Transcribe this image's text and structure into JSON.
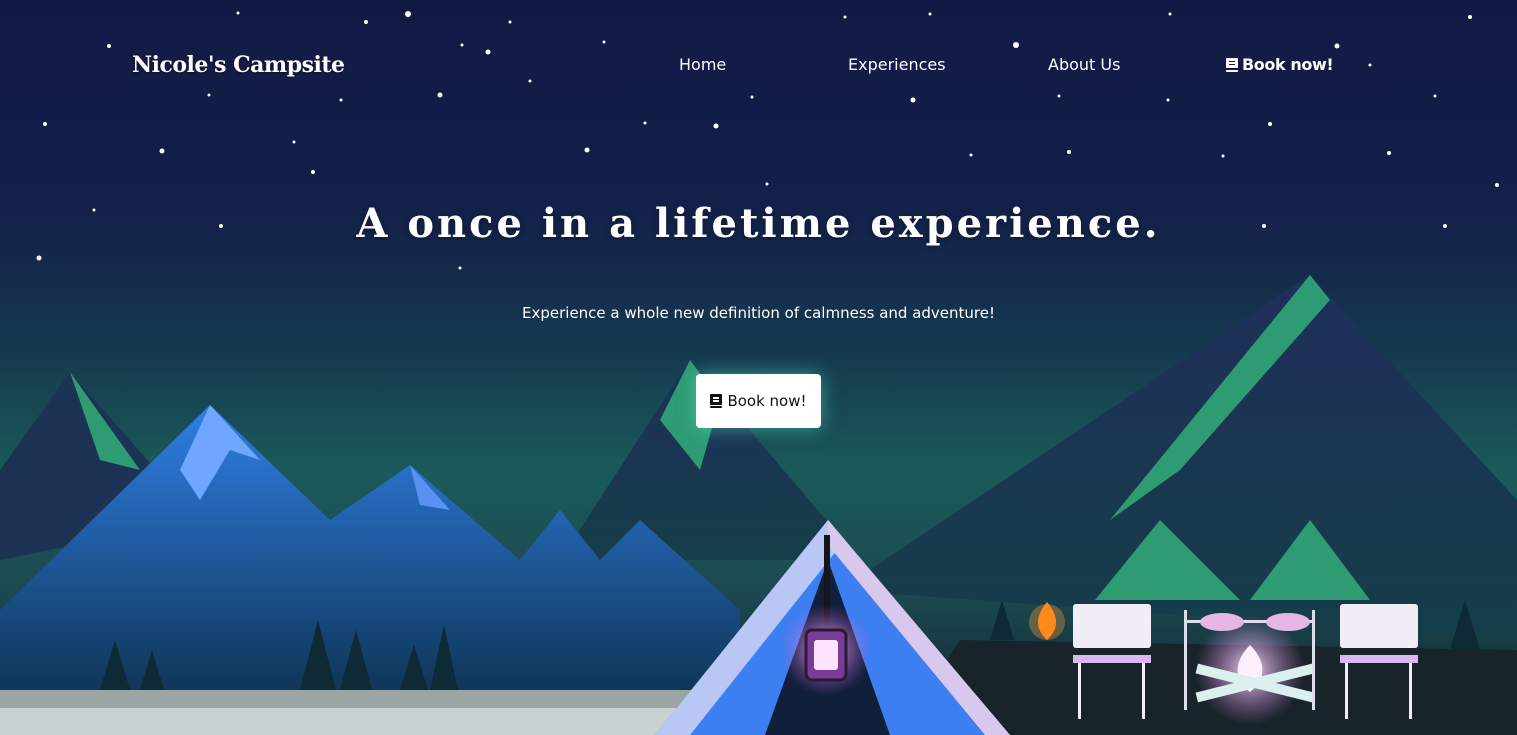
{
  "brand": {
    "name": "Nicole's Campsite"
  },
  "nav": {
    "items": [
      {
        "label": "Home"
      },
      {
        "label": "Experiences"
      },
      {
        "label": "About Us"
      }
    ],
    "book": {
      "label": "Book now!",
      "icon": "book-icon"
    }
  },
  "hero": {
    "title": "A once in a lifetime experience.",
    "subtitle": "Experience a whole new definition of calmness and adventure!",
    "cta": {
      "label": "Book now!",
      "icon": "book-icon"
    }
  },
  "colors": {
    "sky_top": "#121a44",
    "mountain_green": "#2e8f6a",
    "mountain_blue": "#2a6fd6",
    "tent_blue": "#3d7ff0",
    "cta_bg": "#ffffff"
  }
}
